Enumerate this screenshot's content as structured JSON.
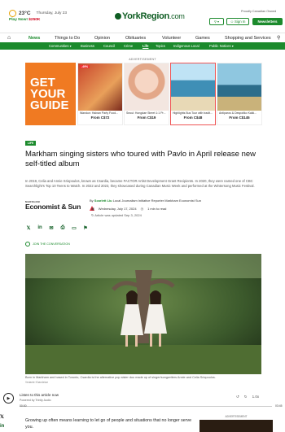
{
  "header": {
    "temperature": "23°C",
    "date": "Thursday, July 23",
    "promo_prefix": "Play Now! ",
    "promo_amount": "$250K",
    "logo_text": "YorkRegion",
    "logo_suffix": ".com",
    "owned": "Proudly Canadian Owned",
    "sign_in": "Sign In",
    "newsletters": "Newsletters"
  },
  "nav": {
    "items": [
      "News",
      "Things to Do",
      "Opinion",
      "Obituaries",
      "Volunteer",
      "Games",
      "Shopping and Services"
    ],
    "active": "News"
  },
  "subnav": {
    "items": [
      "Communities",
      "Business",
      "Council",
      "Crime",
      "Life",
      "Topics",
      "Indigenous Local",
      "Public Notices"
    ],
    "active": "Life"
  },
  "advertisement_label": "ADVERTISEMENT",
  "ad_strip": {
    "banner_text": [
      "GET",
      "YOUR",
      "GUIDE"
    ],
    "cards": [
      {
        "title": "Wandun: Hainan Party Food...",
        "price": "From C$72",
        "tag": "-49%",
        "color": "#c9452c"
      },
      {
        "title": "Seoul: Hongdae Street 1:1 Pr...",
        "price": "From C$19",
        "tag": "",
        "color": "#e8b7a0"
      },
      {
        "title": "Highlights Bus Tour with tradit...",
        "price": "From C$48",
        "tag": "",
        "color": "#3f8fb6"
      },
      {
        "title": "Antiparos & Despotiko Kaiki...",
        "price": "From C$145",
        "tag": "",
        "color": "#7bb6c5"
      }
    ]
  },
  "article": {
    "tag": "LIFE",
    "headline": "Markham singing sisters who toured with Pavlo in April release new self-titled album",
    "dek": "In 2019, Celia and Annie Sriopoulos, known as Csardia, became FACTOR Artist Development Grant Recipients. In 2020, they were named one of CBC Searchlight’s Top 10 Teens to Watch. In 2022 and 2023, they showcased during Canadian Music Week and performed at the Wintersong Music Festival.",
    "publication_small": "MARKHAM",
    "publication": "Economist & Sun",
    "byline_prefix": "By ",
    "author": "Scarlett Liu",
    "author_role": "  Local Journalism Initiative Reporter Markham Economist Sun",
    "date": "Wednesday, July 17, 2024",
    "read_time": "1 min to read",
    "updated": "Article was updated Sep 3, 2024",
    "join_conversation": "JOIN THE CONVERSATION",
    "caption": "Born in Markham and based in Toronto, Csardia is the alternative pop sister duo made up of singer/songwriters Annie and Celia Sriopoulos.",
    "credit": "Vedante Khandekar",
    "body_start": "Growing up often means learning to let go of people and situations that no longer serve you."
  },
  "audio": {
    "title": "Listen to this article now",
    "powered": "Powered by Trinity Audio",
    "time_current": "00:00",
    "time_total": "03:45",
    "speed": "1.0x",
    "progress": 0
  },
  "sidebar_ad_label": "ADVERTISEMENT",
  "colors": {
    "brand_green": "#1b8a2c",
    "dark_green": "#0f5d23",
    "ad_orange": "#f07a22"
  }
}
